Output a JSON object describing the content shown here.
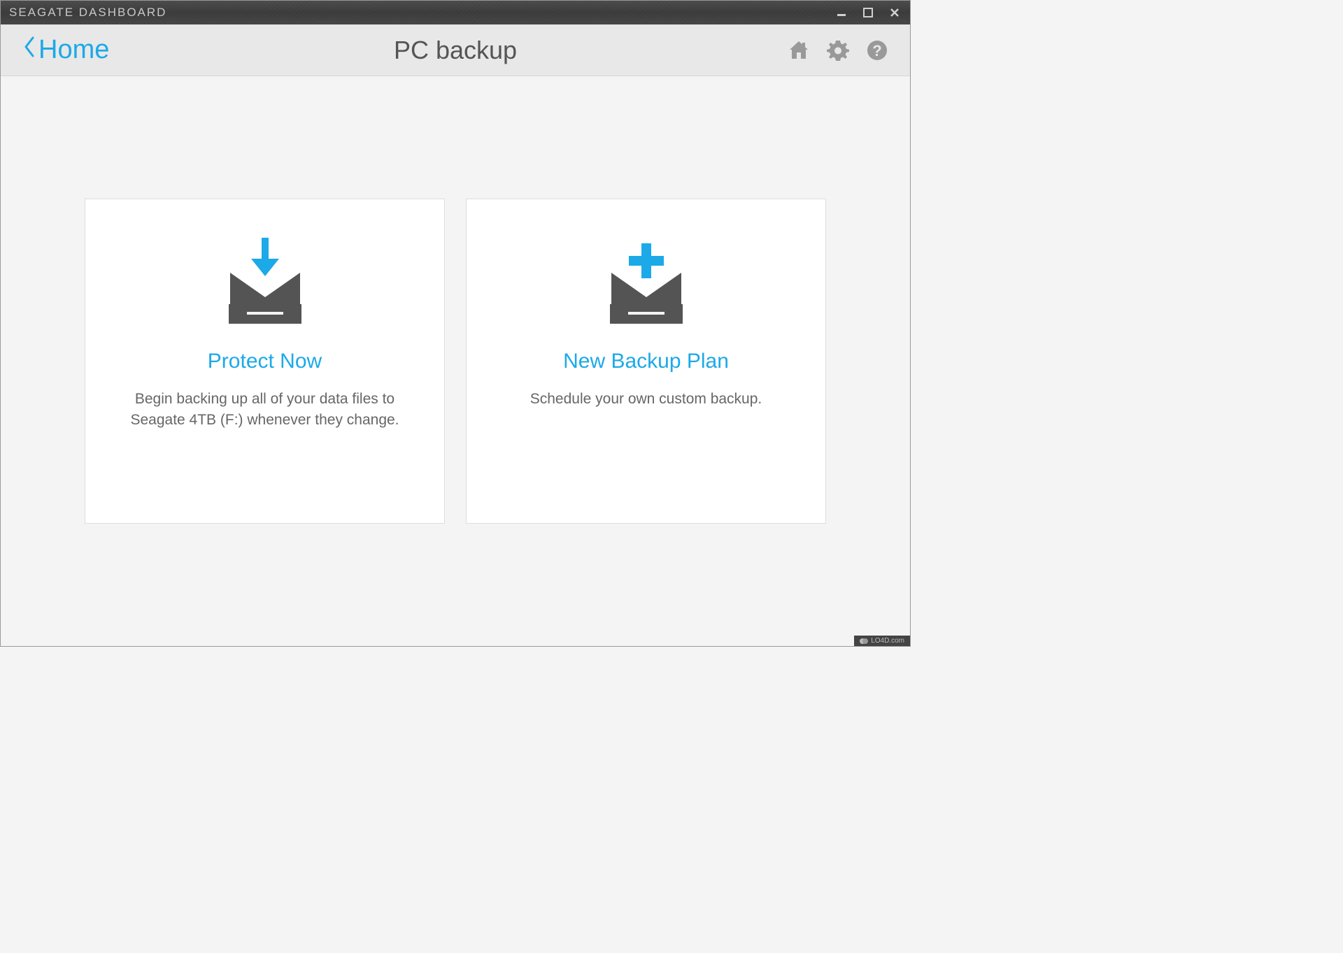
{
  "titlebar": {
    "title": "SEAGATE DASHBOARD"
  },
  "header": {
    "back_label": "Home",
    "page_title": "PC backup"
  },
  "cards": {
    "protect": {
      "title": "Protect Now",
      "description": "Begin backing up all of your data files to Seagate 4TB (F:) whenever they change."
    },
    "newplan": {
      "title": "New Backup Plan",
      "description": "Schedule your own custom backup."
    }
  },
  "footer": {
    "badge": "LO4D.com"
  }
}
